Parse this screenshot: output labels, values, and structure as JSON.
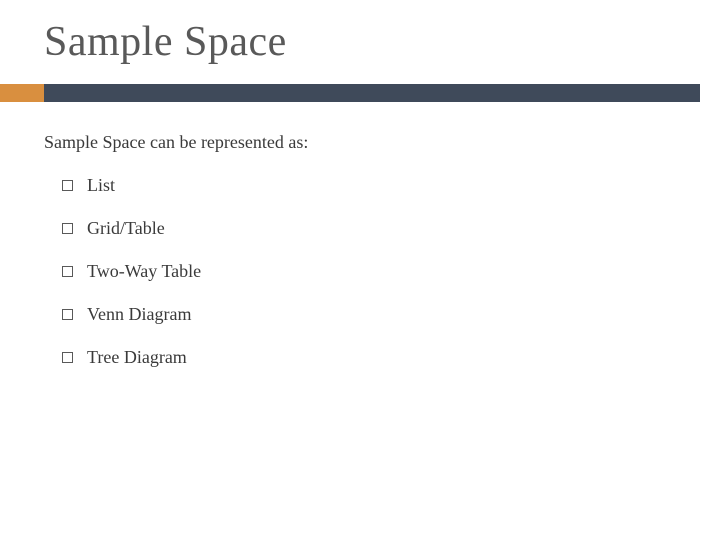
{
  "title": "Sample Space",
  "intro": "Sample Space can be represented as:",
  "items": [
    {
      "label": "List"
    },
    {
      "label": "Grid/Table"
    },
    {
      "label": "Two-Way Table"
    },
    {
      "label": "Venn Diagram"
    },
    {
      "label": "Tree Diagram"
    }
  ]
}
